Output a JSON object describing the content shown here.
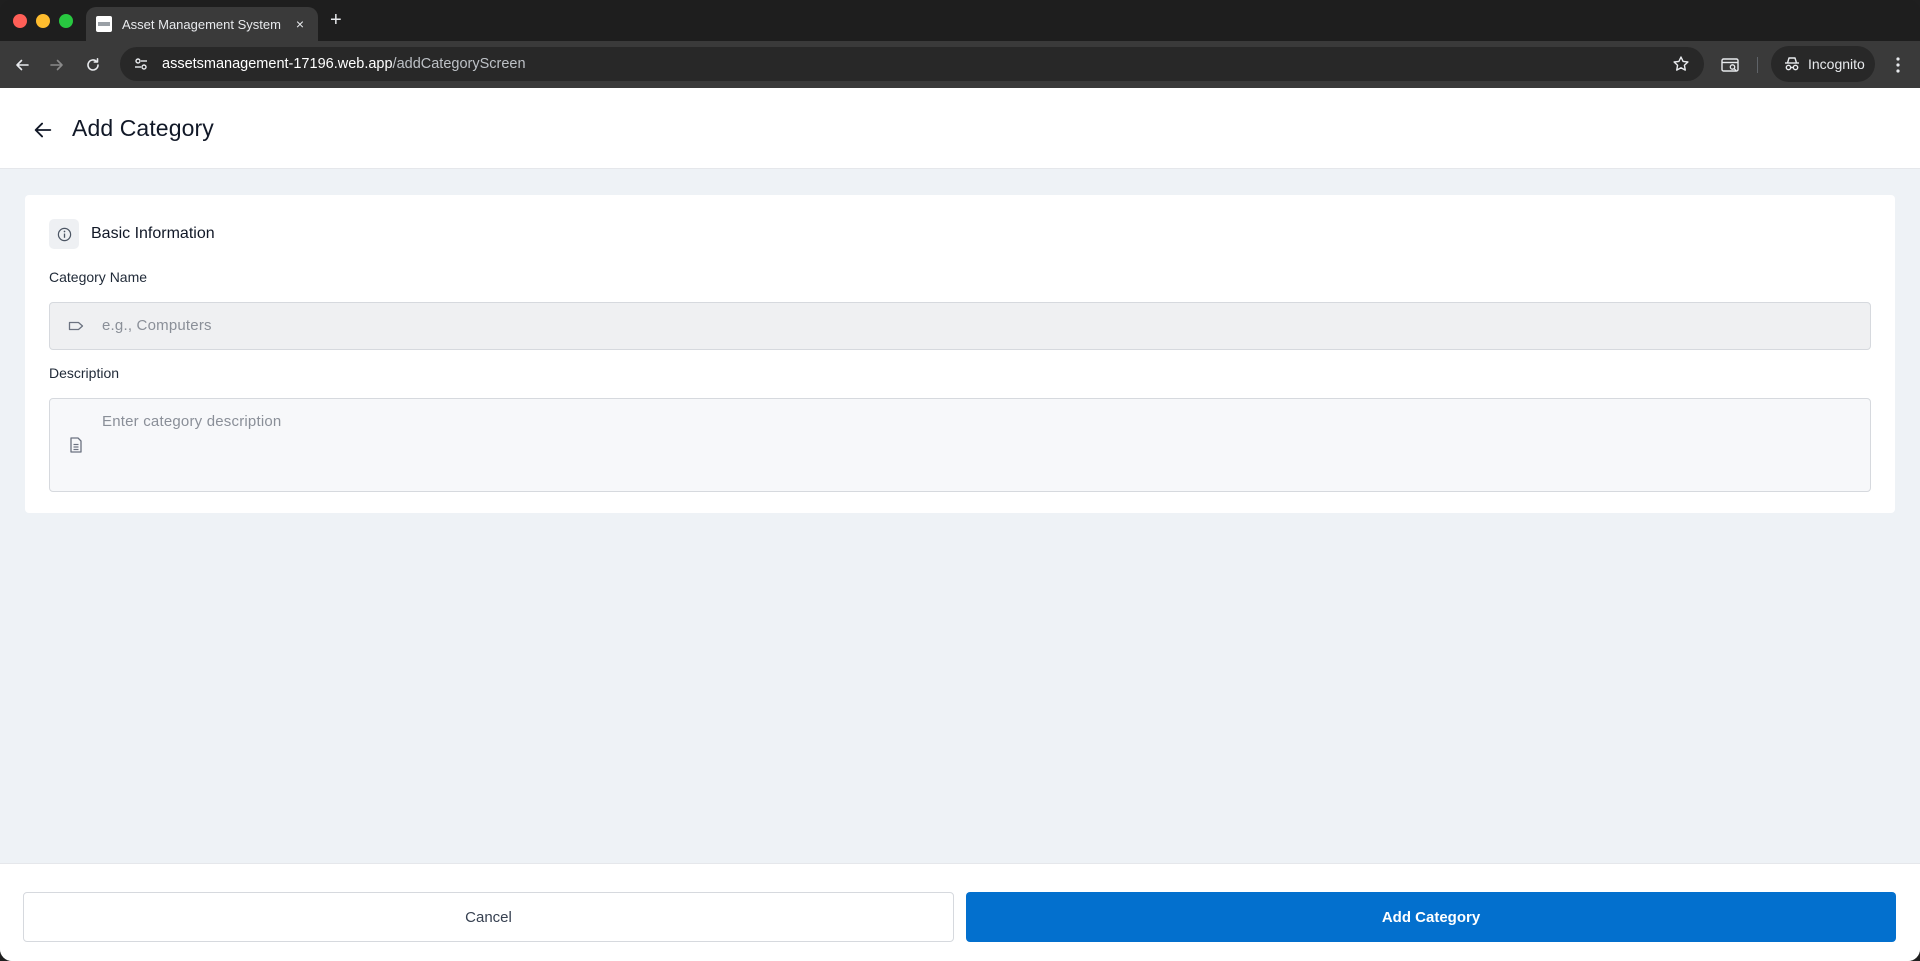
{
  "browser": {
    "tab_title": "Asset Management System",
    "tab_close": "×",
    "new_tab": "+",
    "url_host": "assetsmanagement-17196.web.app",
    "url_path": "/addCategoryScreen",
    "incognito_label": "Incognito"
  },
  "header": {
    "title": "Add Category"
  },
  "form": {
    "section_title": "Basic Information",
    "name_label": "Category Name",
    "name_placeholder": "e.g., Computers",
    "description_label": "Description",
    "description_placeholder": "Enter category description"
  },
  "footer": {
    "cancel_label": "Cancel",
    "submit_label": "Add Category"
  },
  "colors": {
    "primary": "#0370ce",
    "page_background": "#eef2f6"
  }
}
